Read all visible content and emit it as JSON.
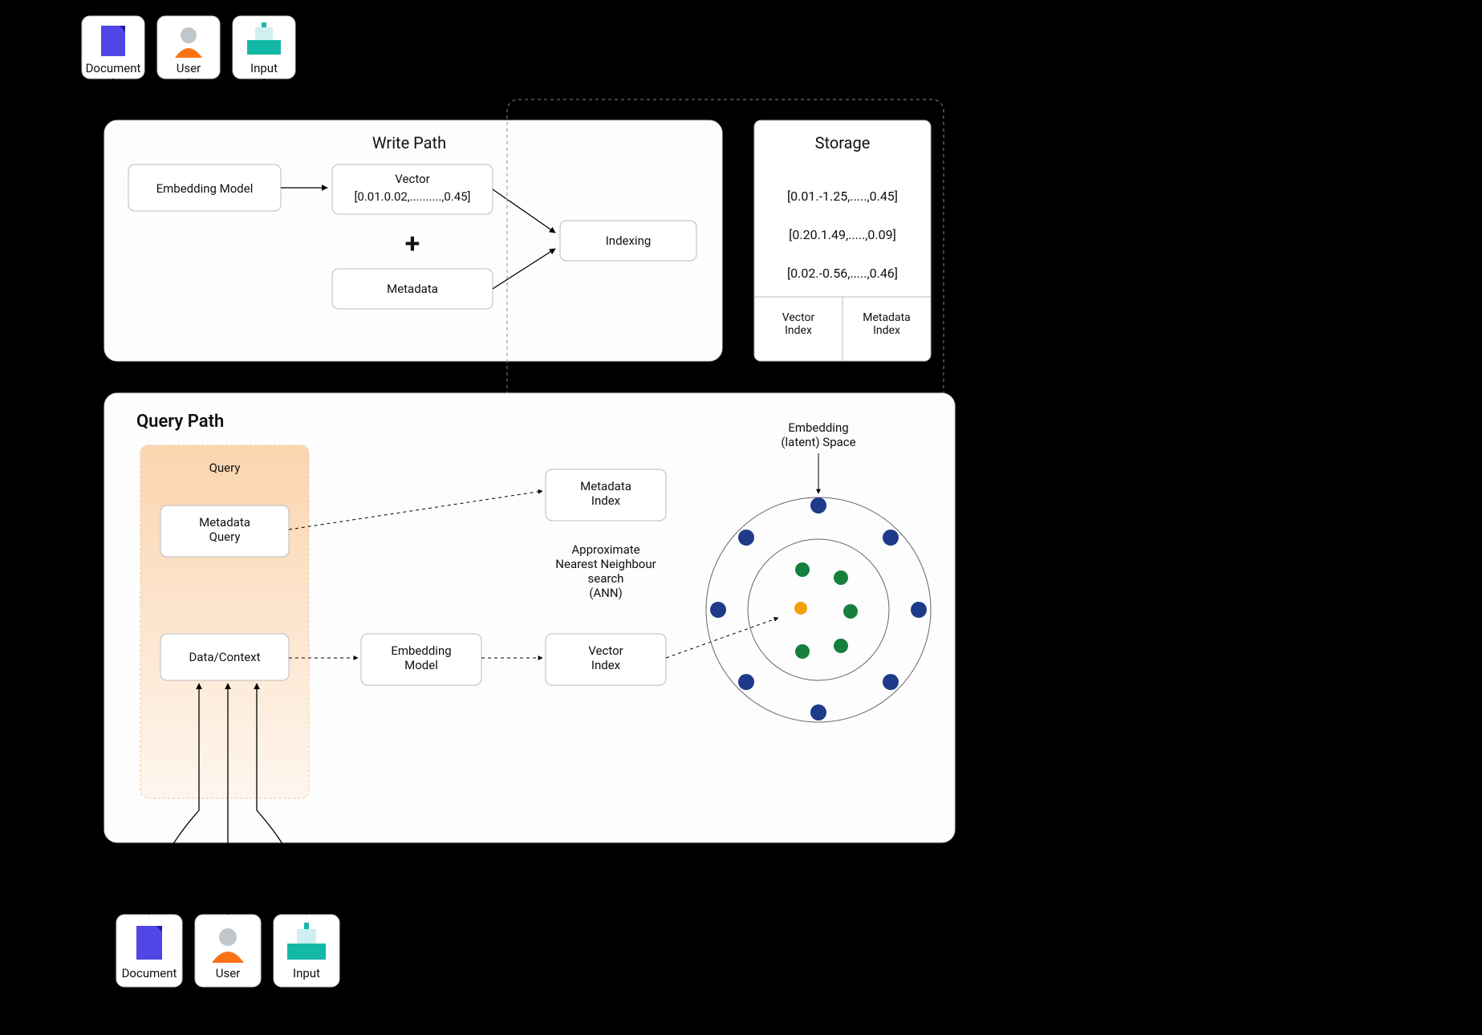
{
  "inputs": {
    "document": "Document",
    "user": "User",
    "input": "Input"
  },
  "write_path": {
    "title": "Write Path",
    "embedding_model": "Embedding Model",
    "vector_label": "Vector",
    "vector_value": "[0.01.0.02,..........,0.45]",
    "metadata": "Metadata",
    "indexing": "Indexing"
  },
  "storage": {
    "title": "Storage",
    "rows": [
      "[0.01.-1.25,.....,0.45]",
      "[0.20.1.49,.....,0.09]",
      "[0.02.-0.56,.....,0.46]"
    ],
    "vector_index": "Vector\nIndex",
    "metadata_index": "Metadata\nIndex"
  },
  "query_path": {
    "title": "Query Path",
    "query_box_title": "Query",
    "metadata_query": "Metadata\nQuery",
    "data_context": "Data/Context",
    "embedding_model": "Embedding\nModel",
    "metadata_index": "Metadata\nIndex",
    "vector_index": "Vector\nIndex",
    "ann": "Approximate\nNearest Neighbour\nsearch\n(ANN)",
    "embedding_space": "Embedding\n(latent) Space"
  }
}
